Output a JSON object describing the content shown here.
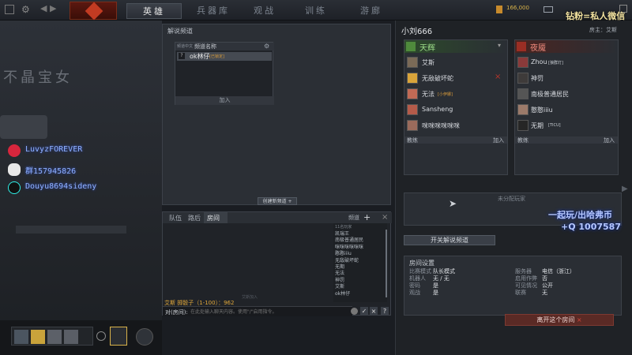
{
  "nav": {
    "tabs": [
      {
        "label": "英雄"
      },
      {
        "label": "兵器库"
      },
      {
        "label": "观战"
      },
      {
        "label": "训练"
      },
      {
        "label": "游廊"
      }
    ],
    "gold": "166,000"
  },
  "overlay": {
    "top_right_watermark": "钻粉=私人微信",
    "mid_watermark_line1": "一起玩/出哈弗币",
    "mid_watermark_line2": "+Q 1007587",
    "left_title": "不晶宝女",
    "socials": [
      {
        "icon": "netease-music-icon",
        "text": "LuvyzFOREVER"
      },
      {
        "icon": "qq-penguin-icon",
        "text": "群157945826"
      },
      {
        "icon": "douyin-icon",
        "text": "Douyu8694sideny"
      }
    ]
  },
  "commentary_panel": {
    "title": "解说频道",
    "col_left": "频道中文",
    "col_channel": "频道名称",
    "channel_member": "ok林仔",
    "channel_tag": "[已锁定]",
    "join_label": "加入",
    "create_label": "创建新频道"
  },
  "chat": {
    "tabs": [
      {
        "label": "队伍"
      },
      {
        "label": "路后"
      },
      {
        "label": "房间"
      }
    ],
    "channel_label": "频道",
    "players_header": "11名玩家",
    "players": [
      "凯瑞王",
      "南极普通居民",
      "咪咪咪咪咪咪",
      "憨憨iiiu",
      "无敌破坏蛇",
      "无期",
      "无法",
      "神罚",
      "艾斯",
      "ok林仔"
    ],
    "system_line": "艾斯 掷骰子（1-100）：962",
    "input_prefix": "对(房间):",
    "input_placeholder": "在此处输入聊天内容。使用\"/\"启用指令。",
    "faint_line": "艾斯加入"
  },
  "lobby": {
    "title": "小刘666",
    "host_label": "房主：艾斯",
    "radiant": {
      "name": "天辉",
      "players": [
        "艾斯",
        "无敌破坏蛇",
        "无法",
        "Sansheng",
        "咪咪咪咪咪咪"
      ],
      "tags": [
        "",
        "",
        "[小伊娜]",
        "",
        ""
      ]
    },
    "dire": {
      "name": "夜魇",
      "players": [
        "Zhou",
        "神罚",
        "南极普通居民",
        "憨憨iiiu",
        "无期"
      ],
      "tags": [
        "[狼群灯]",
        "",
        "",
        "",
        "[TICU]"
      ]
    },
    "coach_label": "教练",
    "join_label": "加入",
    "unassigned_label": "未分配玩家",
    "toggle_commentary": "开关解说频道",
    "settings_title": "房间设置",
    "settings": [
      {
        "label": "比赛模式",
        "value": "队长模式"
      },
      {
        "label": "机器人",
        "value": "无 / 无"
      },
      {
        "label": "密码",
        "value": "是"
      },
      {
        "label": "观战",
        "value": "是"
      },
      {
        "label": "服务器",
        "value": "电信（浙江）"
      },
      {
        "label": "启用作弊",
        "value": "否"
      },
      {
        "label": "可见情况",
        "value": "公开"
      },
      {
        "label": "联赛",
        "value": "无"
      }
    ],
    "leave_label": "离开这个房间"
  }
}
